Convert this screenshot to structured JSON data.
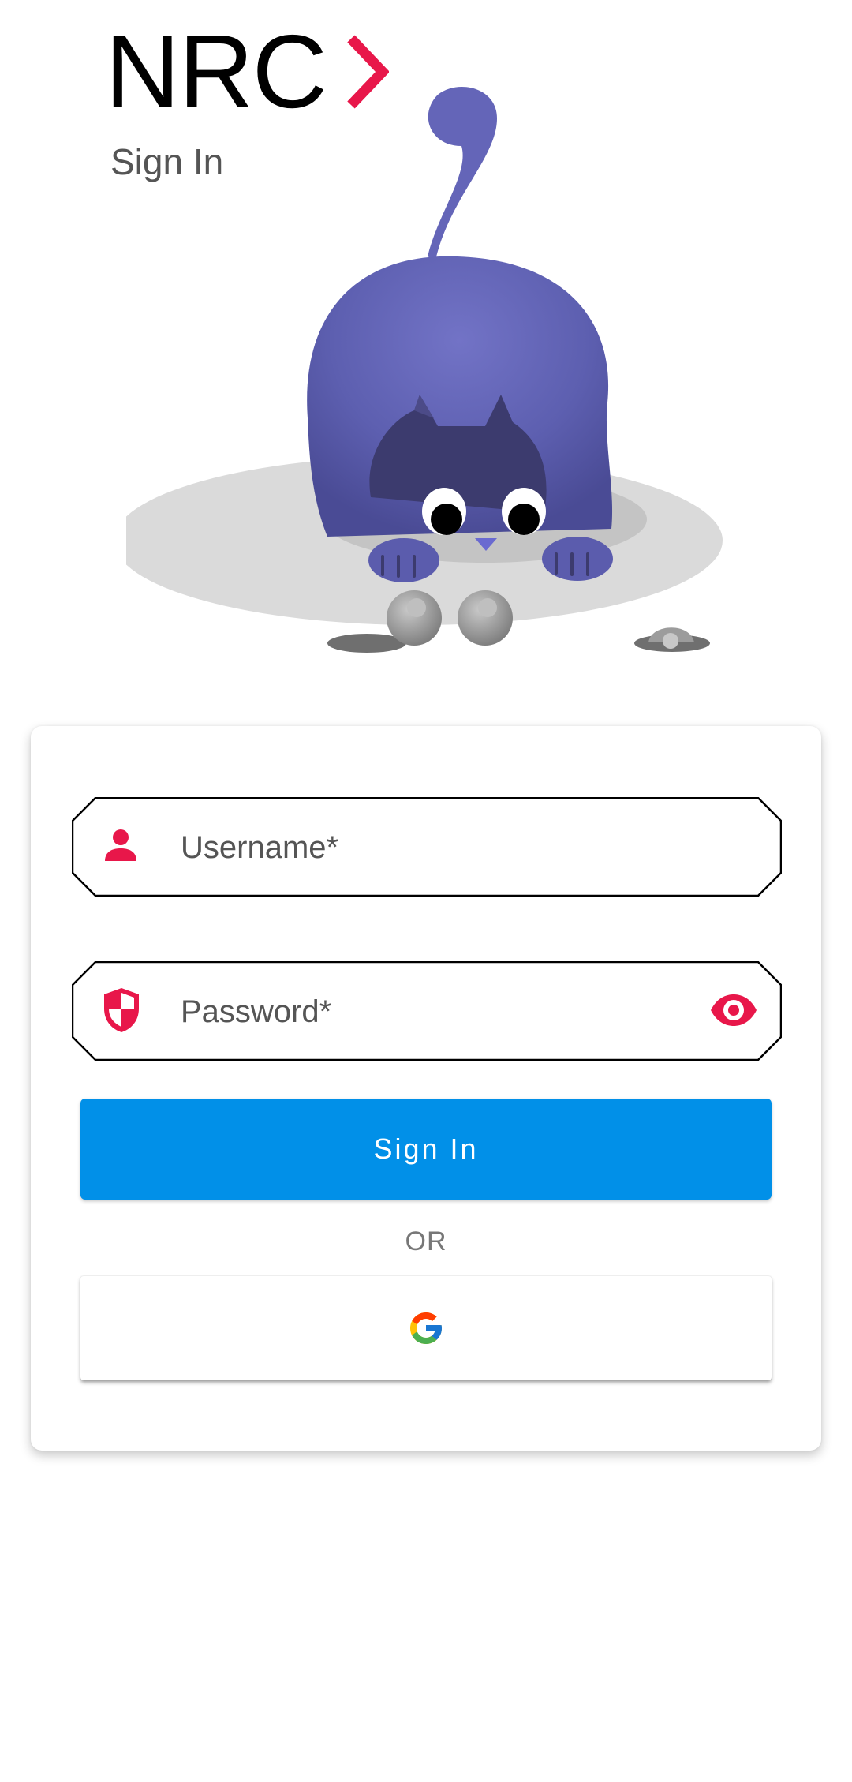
{
  "brand": {
    "name": "NRC",
    "accent_color": "#E8174A"
  },
  "page": {
    "subtitle": "Sign In"
  },
  "illustration": {
    "name": "cat-illustration"
  },
  "form": {
    "username": {
      "placeholder": "Username*",
      "value": "",
      "icon": "person-icon"
    },
    "password": {
      "placeholder": "Password*",
      "value": "",
      "icon": "shield-icon",
      "toggle_icon": "eye-icon"
    },
    "sign_in_label": "Sign In",
    "sign_in_color": "#0190E8",
    "divider_text": "OR",
    "google_icon": "google-icon"
  }
}
